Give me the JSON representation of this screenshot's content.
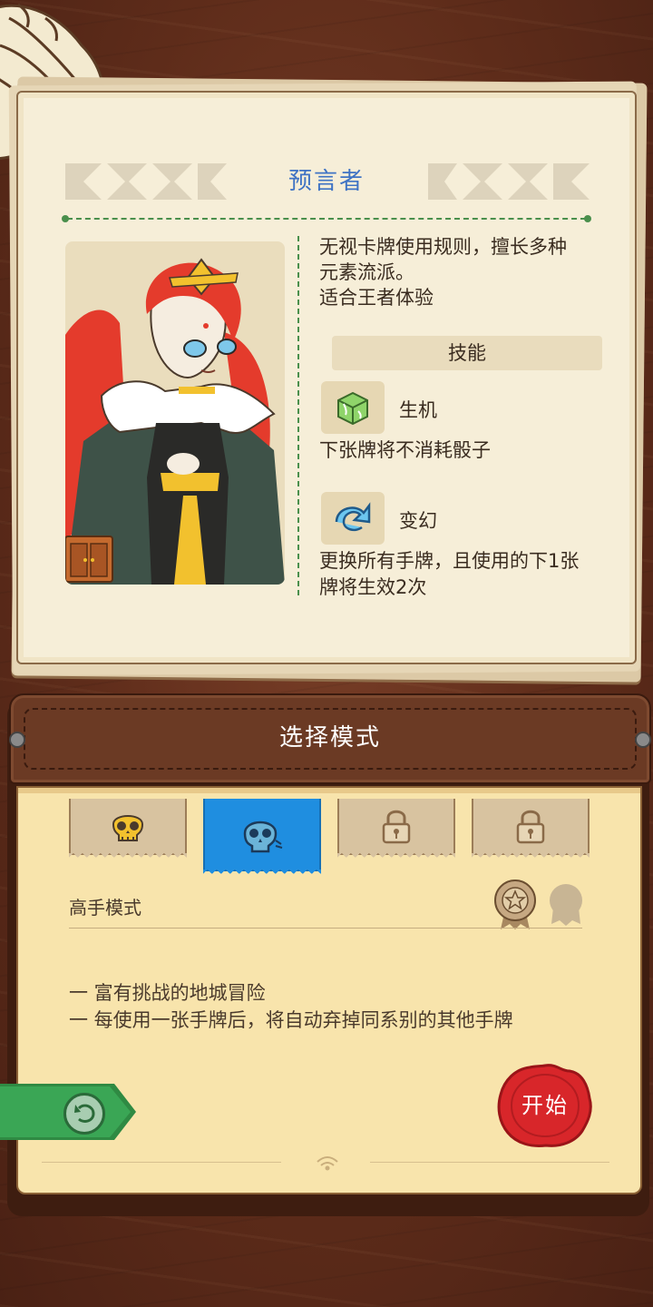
{
  "character": {
    "name": "预言者",
    "description_lines": [
      "无视卡牌使用规则，擅长多种",
      "元素流派。",
      "适合王者体验"
    ],
    "skills_header": "技能",
    "skills": [
      {
        "name": "生机",
        "icon": "green-cube-icon",
        "desc_lines": [
          "下张牌将不消耗骰子"
        ]
      },
      {
        "name": "变幻",
        "icon": "swirl-arrow-icon",
        "desc_lines": [
          "更换所有手牌，且使用的下1张",
          "牌将生效2次"
        ]
      }
    ]
  },
  "mode_panel": {
    "title": "选择模式",
    "tabs": [
      {
        "icon": "golden-skull-icon",
        "state": "available"
      },
      {
        "icon": "blue-skull-icon",
        "state": "selected"
      },
      {
        "icon": "padlock-icon",
        "state": "locked"
      },
      {
        "icon": "padlock-icon",
        "state": "locked"
      }
    ],
    "selected_mode_name": "高手模式",
    "medals": [
      "star-medal-icon",
      "empty-medal-icon"
    ],
    "mode_desc_lines": [
      "一  富有挑战的地城冒险",
      "一  每使用一张手牌后，将自动弃掉同系别的其他手牌"
    ],
    "back_icon": "return-arrow-icon",
    "start_label": "开始"
  },
  "colors": {
    "title_blue": "#3f73c4",
    "selected_tab": "#1f8ee0",
    "start_red": "#d8262a",
    "back_green": "#3aa655"
  }
}
